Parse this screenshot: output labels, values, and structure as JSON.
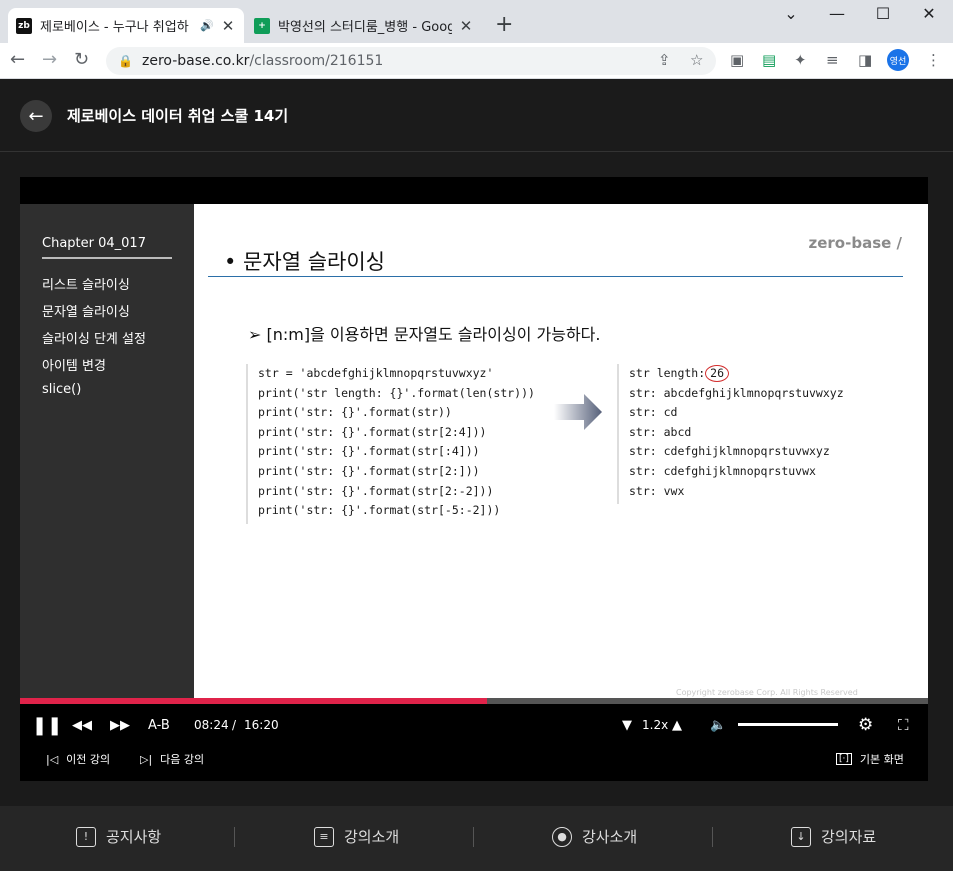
{
  "browser": {
    "tabs": [
      {
        "title": "제로베이스 - 누구나 취업하",
        "favicon": "zb",
        "active": true
      },
      {
        "title": "박영선의 스터디룸_병행 - Goog",
        "favicon": "sheets-icon",
        "active": false
      }
    ],
    "url_host": "zero-base.co.kr",
    "url_path": "/classroom/216151",
    "profile_label": "영선"
  },
  "header": {
    "title": "제로베이스 데이터 취업 스쿨 14기"
  },
  "slide": {
    "chapter": "Chapter  04_017",
    "toc": [
      "리스트 슬라이싱",
      "문자열 슬라이싱",
      "슬라이싱 단계 설정",
      "아이템 변경",
      "slice()"
    ],
    "heading": "• 문자열 슬라이싱",
    "brand": "zero-base /",
    "bullet": "➢  [n:m]을 이용하면 문자열도 슬라이싱이 가능하다.",
    "code_lines": [
      "str = 'abcdefghijklmnopqrstuvwxyz'",
      "print('str length: {}'.format(len(str)))",
      "print('str: {}'.format(str))",
      "print('str: {}'.format(str[2:4]))",
      "print('str: {}'.format(str[:4]))",
      "print('str: {}'.format(str[2:]))",
      "print('str: {}'.format(str[2:-2]))",
      "print('str: {}'.format(str[-5:-2]))"
    ],
    "output_first_label": "str length:",
    "output_first_value": "26",
    "output_lines": [
      "str: abcdefghijklmnopqrstuvwxyz",
      "str: cd",
      "str: abcd",
      "str: cdefghijklmnopqrstuvwxyz",
      "str: cdefghijklmnopqrstuvwx",
      "str: vwx"
    ],
    "copyright": "Copyright zerobase Corp. All Rights Reserved"
  },
  "player": {
    "progress": 0.514,
    "current_time": "08:24",
    "separator": "/",
    "duration": "16:20",
    "ab_label": "A-B",
    "speed": "1.2x",
    "prev_label": "이전 강의",
    "next_label": "다음 강의",
    "view_label": "기본 화면",
    "accent": "#e0234a"
  },
  "bottom_nav": [
    "공지사항",
    "강의소개",
    "강사소개",
    "강의자료"
  ]
}
